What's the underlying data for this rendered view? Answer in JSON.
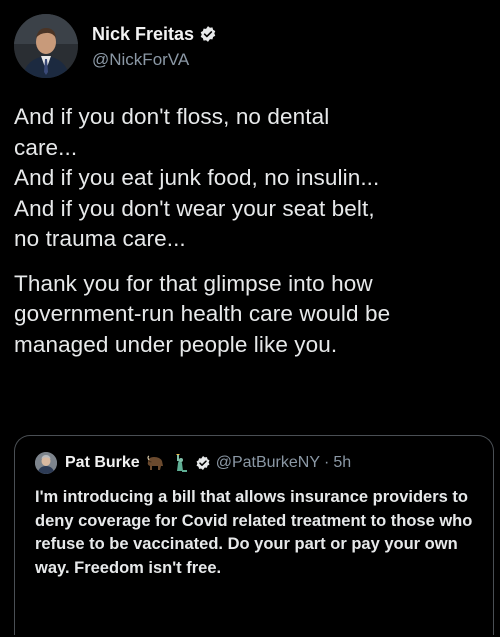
{
  "author": {
    "name": "Nick Freitas",
    "handle": "@NickForVA",
    "verified": true,
    "avatar_icon": "profile-photo"
  },
  "body": {
    "paragraph_1_lines": [
      "And if you don't floss, no dental",
      "care...",
      "And if you eat junk food, no insulin...",
      "And if you don't wear your seat belt,",
      "no trauma care..."
    ],
    "paragraph_2_lines": [
      "Thank you for that glimpse into how",
      "government-run health care would be",
      "managed under people like you."
    ]
  },
  "quoted_tweet": {
    "name": "Pat Burke",
    "emojis": [
      "bison-emoji",
      "statue-of-liberty-emoji"
    ],
    "verified": true,
    "handle": "@PatBurkeNY",
    "separator": "·",
    "time": "5h",
    "text": "I'm introducing a bill that allows insurance providers to deny coverage for Covid related treatment to those who refuse to be vaccinated. Do your part or pay your own way. Freedom isn't free."
  },
  "colors": {
    "background": "#000000",
    "text": "#e7e9ea",
    "secondary": "#8b98a5",
    "border": "#4a4f54"
  }
}
